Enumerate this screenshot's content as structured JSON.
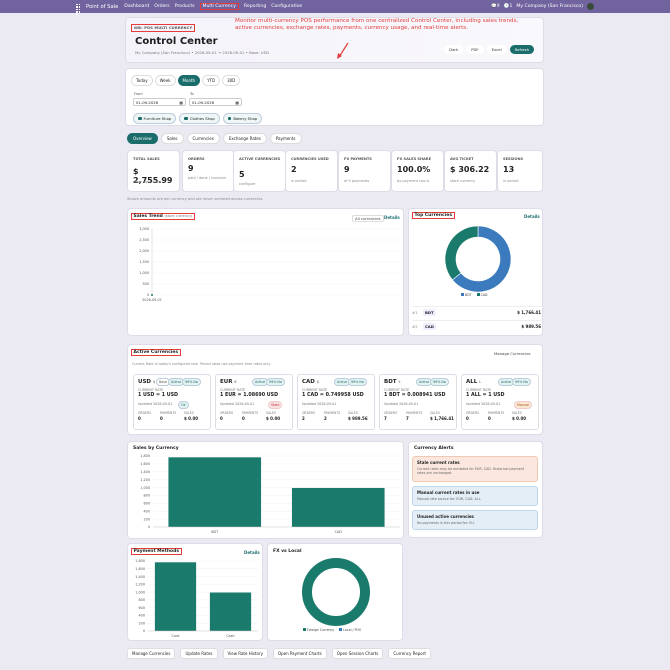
{
  "topbar": {
    "app": "Point of Sale",
    "nav": [
      "Dashboard",
      "Orders",
      "Products",
      "Multi Currency",
      "Reporting",
      "Configuration"
    ],
    "user": "My Company (San Francisco)",
    "badge1": "9",
    "badge2": "1"
  },
  "header": {
    "tag": "WB: POS MULTI CURRENCY",
    "title": "Control Center",
    "subtitle": "My Company (San Francisco) • 2026-09-01 → 2026-09-01 • Base: USD",
    "annotation": "Monitor multi-currency POS performance from one centralized Control Center, including sales trends, active currencies, exchange rates, payments, currency usage, and real-time alerts.",
    "buttons": [
      "Dark",
      "PDF",
      "Excel",
      "Refresh"
    ]
  },
  "filter": {
    "periods": [
      "Today",
      "Week",
      "Month",
      "YTD",
      "30D"
    ],
    "active_period": "Month",
    "from_label": "From",
    "to_label": "To",
    "from": "01-09-2026",
    "to": "01-09-2026",
    "shops": [
      "Furniture Shop",
      "Clothes Shop",
      "Bakery Shop"
    ]
  },
  "tabs": [
    "Overview",
    "Sales",
    "Currencies",
    "Exchange Rates",
    "Payments"
  ],
  "kpis": [
    {
      "label": "TOTAL SALES",
      "value": "$ 2,755.99",
      "sub": "store equivalent"
    },
    {
      "label": "ORDERS",
      "value": "9",
      "sub": "paid / done / invoiced"
    },
    {
      "label": "ACTIVE CURRENCIES",
      "value": "5",
      "sub": "configure"
    },
    {
      "label": "CURRENCIES USED",
      "value": "2",
      "sub": "in period"
    },
    {
      "label": "FX PAYMENTS",
      "value": "9",
      "sub": "of 9 payments"
    },
    {
      "label": "FX SALES SHARE",
      "value": "100.0%",
      "sub": "by payment count"
    },
    {
      "label": "AVG TICKET",
      "value": "$ 306.22",
      "sub": "store currency"
    },
    {
      "label": "SESSIONS",
      "value": "13",
      "sub": "in period"
    }
  ],
  "note": "Shown amounts are per currency and are never summed across currencies.",
  "sales_trend": {
    "title": "Sales Trend",
    "title_sub": "(store currency)",
    "filter": "All currencies",
    "link": "Details"
  },
  "top_currencies": {
    "title": "Top Currencies",
    "link": "Details",
    "rows": [
      {
        "rank": "#1",
        "code": "BDT",
        "amount": "$ 1,766.41"
      },
      {
        "rank": "#2",
        "code": "CAD",
        "amount": "$ 989.56"
      }
    ]
  },
  "active_currencies": {
    "title": "Active Currencies",
    "link": "Manage Currencies",
    "desc": "Current Rate is today's configured rate. Period rates use payment time rates only.",
    "cards": [
      {
        "code": "USD",
        "sym": "$",
        "b1": "Base",
        "b2": "Active",
        "b3": "99% No",
        "rate_label": "CURRENT RATE",
        "rate": "1 USD = 1 USD",
        "updated": "Updated 2026-09-01",
        "status": "Ok",
        "status_type": "ok",
        "orders": "0",
        "payments": "0",
        "sales": "$ 0.00"
      },
      {
        "code": "EUR",
        "sym": "€",
        "b1": "",
        "b2": "Active",
        "b3": "99% No",
        "rate_label": "CURRENT RATE",
        "rate": "1 EUR = 1.08690 USD",
        "updated": "Updated 2026-09-01",
        "status": "Stale",
        "status_type": "red",
        "orders": "0",
        "payments": "0",
        "sales": "$ 0.00"
      },
      {
        "code": "CAD",
        "sym": "$",
        "b1": "",
        "b2": "Active",
        "b3": "99% No",
        "rate_label": "CURRENT RATE",
        "rate": "1 CAD = 0.749958 USD",
        "updated": "Updated 2026-09-01",
        "status": "",
        "status_type": "ok",
        "orders": "2",
        "payments": "2",
        "sales": "$ 989.56"
      },
      {
        "code": "BDT",
        "sym": "৳",
        "b1": "",
        "b2": "Active",
        "b3": "99% No",
        "rate_label": "CURRENT RATE",
        "rate": "1 BDT = 0.008941 USD",
        "updated": "Updated 2026-09-01",
        "status": "",
        "status_type": "ok",
        "orders": "7",
        "payments": "7",
        "sales": "$ 1,766.41"
      },
      {
        "code": "ALL",
        "sym": "L",
        "b1": "",
        "b2": "Active",
        "b3": "99% No",
        "rate_label": "CURRENT RATE",
        "rate": "1 ALL = 1 USD",
        "updated": "Updated 2026-09-01",
        "status": "Manual",
        "status_type": "orange",
        "orders": "0",
        "payments": "0",
        "sales": "$ 0.00"
      }
    ],
    "col_orders": "ORDERS",
    "col_payments": "PAYMENTS",
    "col_sales": "SALES"
  },
  "sales_by_currency": {
    "title": "Sales by Currency"
  },
  "alerts": {
    "title": "Currency Alerts",
    "items": [
      {
        "title": "Stale current rates",
        "desc": "Current rates may be outdated for EUR, CAD. Historical payment rates are unchanged.",
        "type": "warn"
      },
      {
        "title": "Manual current rates in use",
        "desc": "Manual rate source for: EUR, CAD, ALL.",
        "type": "info"
      },
      {
        "title": "Unused active currencies",
        "desc": "No payments in this period for: EU.",
        "type": "info"
      }
    ]
  },
  "payment_methods": {
    "title": "Payment Methods",
    "link": "Details"
  },
  "fx_vs_local": {
    "title": "FX vs Local",
    "legend": [
      "Foreign Currency",
      "Local / POS"
    ]
  },
  "bottom_buttons": [
    "Manage Currencies",
    "Update Rates",
    "View Rate History",
    "Open Payment Charts",
    "Open Session Charts",
    "Currency Report"
  ],
  "chart_data": [
    {
      "type": "line",
      "title": "Sales Trend",
      "x": [
        "2026-09-01"
      ],
      "series": [
        {
          "values": [
            0
          ]
        }
      ],
      "ylim": [
        0,
        3000
      ],
      "yticks": [
        0,
        500,
        1000,
        1500,
        2000,
        2500,
        3000
      ],
      "yticklabels": [
        "0",
        "500",
        "1,000",
        "1,500",
        "2,000",
        "2,500",
        "3,000"
      ]
    },
    {
      "type": "pie",
      "title": "Top Currencies",
      "categories": [
        "BDT",
        "CAD"
      ],
      "values": [
        1766.41,
        989.56
      ],
      "colors": [
        "#3b7bbd",
        "#1a7a6b"
      ]
    },
    {
      "type": "bar",
      "title": "Sales by Currency",
      "categories": [
        "BDT",
        "CAD"
      ],
      "values": [
        1766.41,
        989.56
      ],
      "ylim": [
        0,
        1800
      ],
      "yticks": [
        0,
        200,
        400,
        600,
        800,
        1000,
        1200,
        1400,
        1600,
        1800
      ],
      "yticklabels": [
        "0",
        "200",
        "400",
        "600",
        "800",
        "1,000",
        "1,200",
        "1,400",
        "1,600",
        "1,800"
      ],
      "color": "#1a7a6b"
    },
    {
      "type": "bar",
      "title": "Payment Methods",
      "categories": [
        "Card",
        "Cash"
      ],
      "values": [
        1766.41,
        989.56
      ],
      "ylim": [
        0,
        1800
      ],
      "yticks": [
        0,
        200,
        400,
        600,
        800,
        1000,
        1200,
        1400,
        1600,
        1800
      ],
      "yticklabels": [
        "0",
        "200",
        "400",
        "600",
        "800",
        "1,000",
        "1,200",
        "1,400",
        "1,600",
        "1,800"
      ],
      "color": "#1a7a6b"
    },
    {
      "type": "pie",
      "title": "FX vs Local",
      "categories": [
        "Foreign Currency",
        "Local / POS"
      ],
      "values": [
        100,
        0
      ],
      "colors": [
        "#1a7a6b",
        "#3b7bbd"
      ]
    }
  ]
}
